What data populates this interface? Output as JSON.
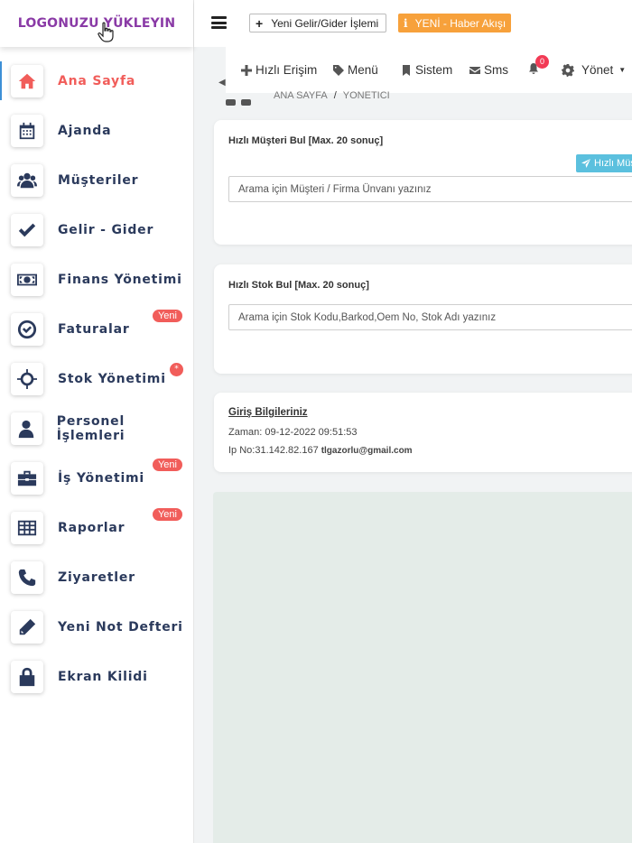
{
  "logo": {
    "text": "LOGONUZU YÜKLEYIN"
  },
  "sidebar": {
    "items": [
      {
        "label": "Ana Sayfa",
        "icon": "home-icon",
        "badge": ""
      },
      {
        "label": "Ajanda",
        "icon": "calendar-icon",
        "badge": ""
      },
      {
        "label": "Müşteriler",
        "icon": "users-icon",
        "badge": ""
      },
      {
        "label": "Gelir - Gider",
        "icon": "check-icon",
        "badge": ""
      },
      {
        "label": "Finans Yönetimi",
        "icon": "money-icon",
        "badge": ""
      },
      {
        "label": "Faturalar",
        "icon": "check-circle-icon",
        "badge": "Yeni"
      },
      {
        "label": "Stok Yönetimi",
        "icon": "crosshairs-icon",
        "badge": "*"
      },
      {
        "label": "Personel İşlemleri",
        "icon": "user-icon",
        "badge": ""
      },
      {
        "label": "İş Yönetimi",
        "icon": "briefcase-icon",
        "badge": "Yeni"
      },
      {
        "label": "Raporlar",
        "icon": "table-icon",
        "badge": "Yeni"
      },
      {
        "label": "Ziyaretler",
        "icon": "phone-icon",
        "badge": ""
      },
      {
        "label": "Yeni Not Defteri",
        "icon": "pencil-icon",
        "badge": ""
      },
      {
        "label": "Ekran Kilidi",
        "icon": "lock-icon",
        "badge": ""
      }
    ]
  },
  "topbar": {
    "new_entry_label": "Yeni Gelir/Gider İşlemi",
    "news_label": "YENİ - Haber Akışı",
    "news_icon": "info-icon"
  },
  "menubar": {
    "quick_access": "Hızlı Erişim",
    "menu": "Menü",
    "system": "Sistem",
    "sms": "Sms",
    "notification_count": "0",
    "manage": "Yönet"
  },
  "breadcrumb": {
    "home": "ANA SAYFA",
    "sep": "/",
    "current": "YONETICI"
  },
  "customer_search": {
    "title": "Hızlı Müşteri Bul [Max. 20 sonuç]",
    "button_label": "Hızlı Müş",
    "placeholder": "Arama için Müşteri / Firma Ünvanı yazınız"
  },
  "stock_search": {
    "title": "Hızlı Stok Bul [Max. 20 sonuç]",
    "placeholder": "Arama için Stok Kodu,Barkod,Oem No, Stok Adı yazınız"
  },
  "login_info": {
    "title": "Giriş Bilgileriniz",
    "time_line": "Zaman: 09-12-2022 09:51:53",
    "ip_line": "Ip No:31.142.82.167",
    "email": "tlgazorlu@gmail.com"
  },
  "colors": {
    "accent": "#f15d5a",
    "nav_text": "#2b3a5c",
    "logo": "#8a3aa6",
    "news": "#f7a13b",
    "info_btn": "#5bc0de"
  }
}
